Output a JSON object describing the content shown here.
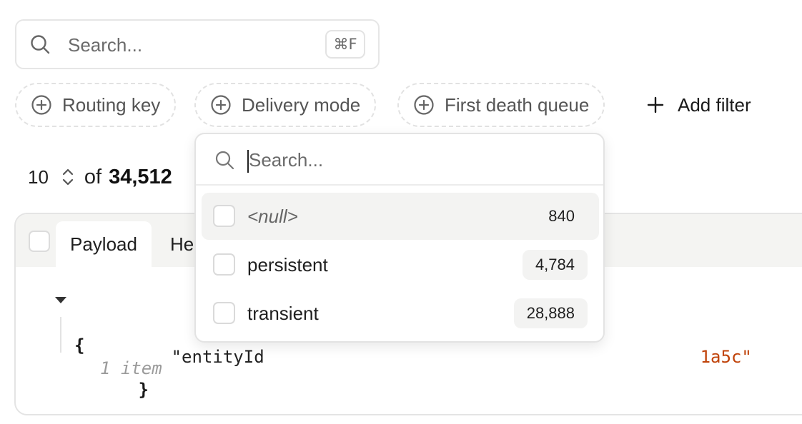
{
  "search": {
    "placeholder": "Search...",
    "shortcut": "⌘F"
  },
  "filters": [
    {
      "label": "Routing key"
    },
    {
      "label": "Delivery mode"
    },
    {
      "label": "First death queue"
    }
  ],
  "add_filter_label": "Add filter",
  "pagination": {
    "page_size": "10",
    "of_label": "of",
    "total": "34,512"
  },
  "table": {
    "tabs": [
      {
        "label": "Payload"
      },
      {
        "label": "He"
      }
    ],
    "json_preview": {
      "open_brace": "{",
      "item_count": "1 item",
      "key": "\"entityId",
      "value_tail": "1a5c\"",
      "close_brace": "}"
    }
  },
  "dropdown": {
    "search_placeholder": "Search...",
    "options": [
      {
        "label": "<null>",
        "count": "840"
      },
      {
        "label": "persistent",
        "count": "4,784"
      },
      {
        "label": "transient",
        "count": "28,888"
      }
    ]
  },
  "colors": {
    "json_string": "#c0430a",
    "chip_border": "#e2e2e2",
    "hover_row": "#f3f3f2"
  },
  "icons": [
    "search-icon",
    "plus-circle-icon",
    "plus-icon",
    "sort-icon",
    "caret-down-icon"
  ]
}
